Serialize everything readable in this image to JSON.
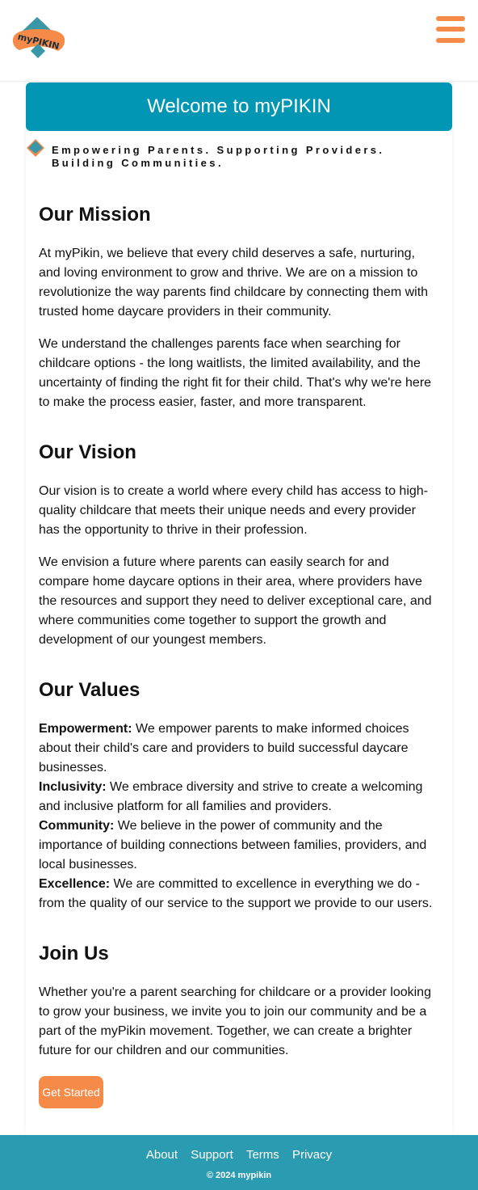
{
  "header": {
    "logo_text": "myPIKIN",
    "menu_icon": "hamburger-menu-icon",
    "brand_colors": {
      "orange": "#f68b49",
      "teal": "#3a97a7"
    }
  },
  "hero": {
    "title": "Welcome to myPIKIN",
    "tagline": "Empowering Parents. Supporting Providers. Building Communities.",
    "color": "#0096b4"
  },
  "mission": {
    "heading": "Our Mission",
    "p1": "At myPikin, we believe that every child deserves a safe, nurturing, and loving environment to grow and thrive. We are on a mission to revolutionize the way parents find childcare by connecting them with trusted home daycare providers in their community.",
    "p2": "We understand the challenges parents face when searching for childcare options - the long waitlists, the limited availability, and the uncertainty of finding the right fit for their child. That's why we're here to make the process easier, faster, and more transparent."
  },
  "vision": {
    "heading": "Our Vision",
    "p1": "Our vision is to create a world where every child has access to high-quality childcare that meets their unique needs and every provider has the opportunity to thrive in their profession.",
    "p2": "We envision a future where parents can easily search for and compare home daycare options in their area, where providers have the resources and support they need to deliver exceptional care, and where communities come together to support the growth and development of our youngest members."
  },
  "values": {
    "heading": "Our Values",
    "items": [
      {
        "term": "Empowerment:",
        "text": " We empower parents to make informed choices about their child's care and providers to build successful daycare businesses."
      },
      {
        "term": "Inclusivity:",
        "text": " We embrace diversity and strive to create a welcoming and inclusive platform for all families and providers."
      },
      {
        "term": "Community:",
        "text": " We believe in the power of community and the importance of building connections between families, providers, and local businesses."
      },
      {
        "term": "Excellence:",
        "text": " We are committed to excellence in everything we do - from the quality of our service to the support we provide to our users."
      }
    ]
  },
  "join": {
    "heading": "Join Us",
    "p1": "Whether you're a parent searching for childcare or a provider looking to grow your business, we invite you to join our community and be a part of the myPikin movement. Together, we can create a brighter future for our children and our communities.",
    "button": "Get Started"
  },
  "footer": {
    "links": [
      "About",
      "Support",
      "Terms",
      "Privacy"
    ],
    "copyright": "© 2024 mypikin",
    "color": "#2a9bb0"
  }
}
